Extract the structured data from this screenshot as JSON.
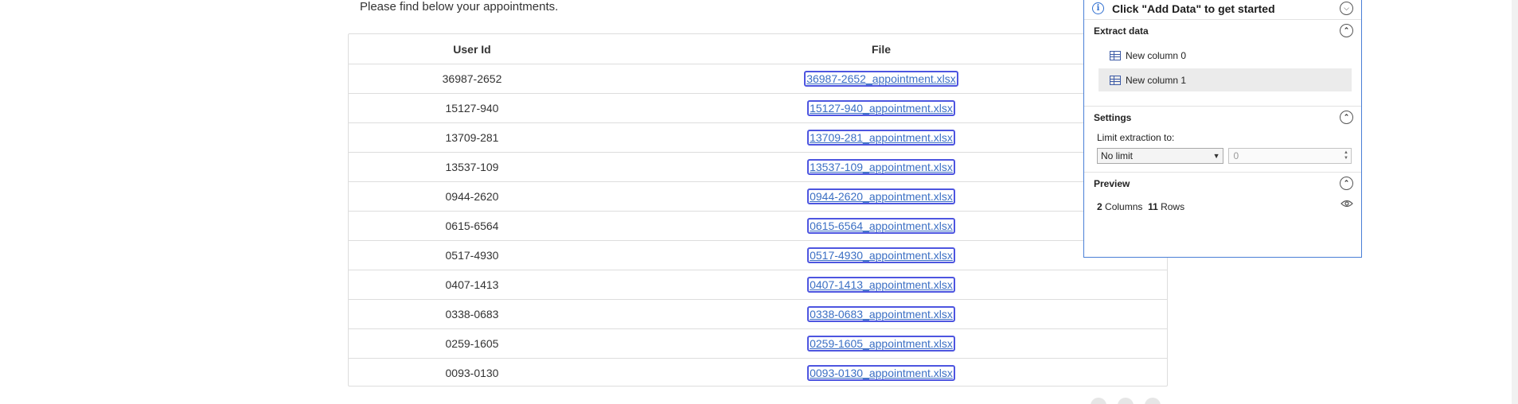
{
  "intro_text": "Please find below your appointments.",
  "table": {
    "headers": {
      "user_id": "User Id",
      "file": "File"
    },
    "rows": [
      {
        "user_id": "36987-2652",
        "file": "36987-2652_appointment.xlsx"
      },
      {
        "user_id": "15127-940",
        "file": "15127-940_appointment.xlsx"
      },
      {
        "user_id": "13709-281",
        "file": "13709-281_appointment.xlsx"
      },
      {
        "user_id": "13537-109",
        "file": "13537-109_appointment.xlsx"
      },
      {
        "user_id": "0944-2620",
        "file": "0944-2620_appointment.xlsx"
      },
      {
        "user_id": "0615-6564",
        "file": "0615-6564_appointment.xlsx"
      },
      {
        "user_id": "0517-4930",
        "file": "0517-4930_appointment.xlsx"
      },
      {
        "user_id": "0407-1413",
        "file": "0407-1413_appointment.xlsx"
      },
      {
        "user_id": "0338-0683",
        "file": "0338-0683_appointment.xlsx"
      },
      {
        "user_id": "0259-1605",
        "file": "0259-1605_appointment.xlsx"
      },
      {
        "user_id": "0093-0130",
        "file": "0093-0130_appointment.xlsx"
      }
    ]
  },
  "panel": {
    "header_title": "Click \"Add Data\" to get started",
    "extract": {
      "title": "Extract data",
      "columns": [
        "New column 0",
        "New column 1"
      ],
      "selected_index": 1
    },
    "settings": {
      "title": "Settings",
      "limit_label": "Limit extraction to:",
      "limit_selected": "No limit",
      "limit_value": "0"
    },
    "preview": {
      "title": "Preview",
      "columns_count": "2",
      "columns_label": "Columns",
      "rows_count": "11",
      "rows_label": "Rows"
    }
  },
  "colors": {
    "link": "#3b6fc4",
    "highlight_border": "#4d55e0",
    "panel_border": "#4a7fd6"
  },
  "icons": {
    "header": "info-icon",
    "collapse": "chevron-down-icon",
    "expand": "chevron-up-icon",
    "column": "table-column-icon",
    "preview": "eye-icon"
  }
}
